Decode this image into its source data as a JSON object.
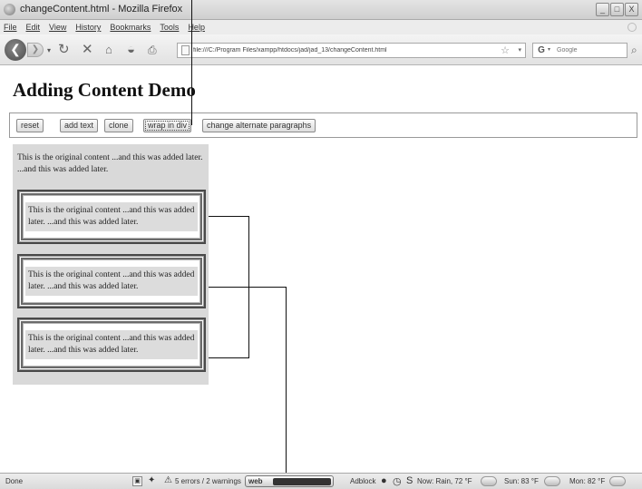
{
  "window": {
    "title": "changeContent.html - Mozilla Firefox",
    "controls": [
      "_",
      "□",
      "X"
    ]
  },
  "menu": [
    "File",
    "Edit",
    "View",
    "History",
    "Bookmarks",
    "Tools",
    "Help"
  ],
  "nav": {
    "url": "file:///C:/Program Files/xampp/htdocs/jad/jad_13/changeContent.html",
    "search_placeholder": "Google",
    "search_engine_glyph": "G",
    "icons": [
      "back-icon",
      "forward-icon",
      "history-dropdown-icon",
      "reload-icon",
      "stop-icon",
      "home-icon",
      "user-agent-icon",
      "print-icon",
      "bookmark-star-icon",
      "search-go-icon"
    ]
  },
  "page": {
    "title": "Adding Content Demo",
    "buttons": [
      {
        "id": "reset",
        "label": "reset"
      },
      {
        "id": "add_text",
        "label": "add text"
      },
      {
        "id": "clone",
        "label": "clone"
      },
      {
        "id": "wrap_in_div",
        "label": "wrap in div"
      },
      {
        "id": "change_alternate",
        "label": "change alternate paragraphs"
      }
    ],
    "original_paragraph": "This is the original content ...and this was added later. ...and this was added later.",
    "wrapped_paragraphs": [
      "This is the original content ...and this was added later. ...and this was added later.",
      "This is the original content ...and this was added later. ...and this was added later.",
      "This is the original content ...and this was added later. ...and this was added later."
    ]
  },
  "status": {
    "left": "Done",
    "errors": "5 errors / 2 warnings",
    "webdev": "web",
    "adblock": "Adblock",
    "s_glyph": "S",
    "weather_now": "Now: Rain, 72 °F",
    "weather_sun": "Sun: 83 °F",
    "weather_mon": "Mon: 82 °F"
  }
}
